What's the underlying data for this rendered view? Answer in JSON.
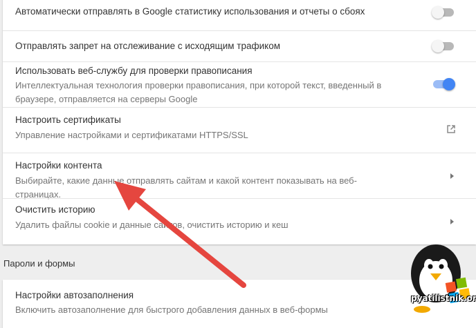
{
  "settings": {
    "rows": [
      {
        "title": "Автоматически отправлять в Google статистику использования и отчеты о сбоях",
        "control": "toggle-off"
      },
      {
        "title": "Отправлять запрет на отслеживание с исходящим трафиком",
        "control": "toggle-off"
      },
      {
        "title": "Использовать веб-службу для проверки правописания",
        "subtitle": "Интеллектуальная технология проверки правописания, при которой текст, введенный в браузере, отправляется на серверы Google",
        "control": "toggle-on"
      },
      {
        "title": "Настроить сертификаты",
        "subtitle": "Управление настройками и сертификатами HTTPS/SSL",
        "control": "external-link-icon"
      },
      {
        "title": "Настройки контента",
        "subtitle": "Выбирайте, какие данные отправлять сайтам и какой контент показывать на веб-страницах.",
        "control": "chevron-right-icon"
      },
      {
        "title": "Очистить историю",
        "subtitle": "Удалить файлы cookie и данные сайтов, очистить историю и кеш",
        "control": "chevron-right-icon"
      }
    ]
  },
  "passwords_section": {
    "title": "Пароли и формы",
    "rows": [
      {
        "title": "Настройки автозаполнения",
        "subtitle": "Включить автозаполнение для быстрого добавления данных в веб-формы"
      }
    ]
  },
  "watermark": {
    "text": "pyatilistnik.org"
  },
  "colors": {
    "accent": "#4285f4",
    "arrow": "#e5463f"
  }
}
